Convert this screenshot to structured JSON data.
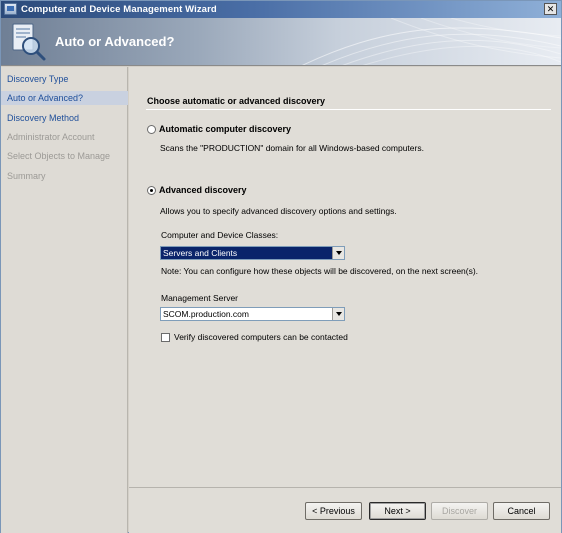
{
  "window": {
    "title": "Computer and Device Management Wizard",
    "close_glyph": "✕"
  },
  "header": {
    "title": "Auto or Advanced?"
  },
  "nav": {
    "items": [
      {
        "label": "Discovery Type"
      },
      {
        "label": "Auto or Advanced?"
      },
      {
        "label": "Discovery Method"
      },
      {
        "label": "Administrator Account"
      },
      {
        "label": "Select Objects to Manage"
      },
      {
        "label": "Summary"
      }
    ]
  },
  "main": {
    "section_title": "Choose automatic or advanced discovery",
    "automatic": {
      "label": "Automatic computer discovery",
      "description": "Scans the \"PRODUCTION\" domain for all Windows-based computers.",
      "checked": false
    },
    "advanced": {
      "label": "Advanced discovery",
      "description": "Allows you to specify advanced discovery options and settings.",
      "checked": true
    },
    "classes": {
      "label": "Computer and Device Classes:",
      "value": "Servers and Clients",
      "note": "Note: You can configure how these objects will be discovered, on the next screen(s)."
    },
    "server": {
      "label": "Management Server",
      "value": "SCOM.production.com"
    },
    "verify": {
      "label": "Verify discovered computers can be contacted",
      "checked": false
    }
  },
  "buttons": {
    "previous": "< Previous",
    "next": "Next >",
    "discover": "Discover",
    "cancel": "Cancel"
  },
  "colors": {
    "title_bar": "#2b4a7a",
    "nav_link": "#1f4f9a",
    "selected_fill": "#0a246a"
  }
}
